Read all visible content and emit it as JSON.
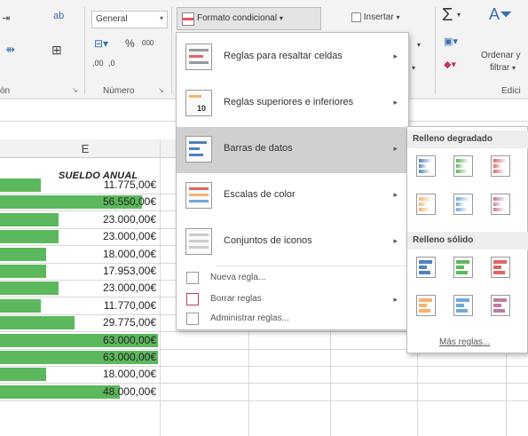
{
  "ribbon": {
    "orientation_label": "ab",
    "number_format": "General",
    "percent_label": "%",
    "thousands_label": "000",
    "decimals_label": ",00",
    "cond_format_label": "Formato condicional",
    "insert_label": "Insertar",
    "sort_label": "Ordenar y",
    "filter_label": "filtrar",
    "group_alignment": "ón",
    "group_number": "Número",
    "group_editing": "Edici"
  },
  "sheet": {
    "column_letter": "E",
    "column_header": "SUELDO ANUAL",
    "rows": [
      {
        "value": "11.775,00€",
        "fill": 0.26
      },
      {
        "value": "56.550,00€",
        "fill": 0.9
      },
      {
        "value": "23.000,00€",
        "fill": 0.37
      },
      {
        "value": "23.000,00€",
        "fill": 0.37
      },
      {
        "value": "18.000,00€",
        "fill": 0.29
      },
      {
        "value": "17.953,00€",
        "fill": 0.29
      },
      {
        "value": "23.000,00€",
        "fill": 0.37
      },
      {
        "value": "11.770,00€",
        "fill": 0.26
      },
      {
        "value": "29.775,00€",
        "fill": 0.47
      },
      {
        "value": "63.000,00€",
        "fill": 1.0
      },
      {
        "value": "63.000,00€",
        "fill": 1.0
      },
      {
        "value": "18.000,00€",
        "fill": 0.29
      },
      {
        "value": "48.000,00€",
        "fill": 0.76
      }
    ],
    "bar_color": "#5cb85c"
  },
  "menu": {
    "items": [
      {
        "label": "Reglas para resaltar celdas",
        "has_submenu": true
      },
      {
        "label": "Reglas superiores e inferiores",
        "has_submenu": true
      },
      {
        "label": "Barras de datos",
        "has_submenu": true,
        "highlighted": true
      },
      {
        "label": "Escalas de color",
        "has_submenu": true
      },
      {
        "label": "Conjuntos de iconos",
        "has_submenu": true
      }
    ],
    "small_items": [
      {
        "label": "Nueva regla...",
        "has_submenu": false
      },
      {
        "label": "Borrar reglas",
        "has_submenu": true
      },
      {
        "label": "Administrar reglas...",
        "has_submenu": false
      }
    ],
    "icon_badge": "10"
  },
  "submenu": {
    "gradient_title": "Relleno degradado",
    "solid_title": "Relleno sólido",
    "more_label": "Más reglas...",
    "swatch_colors": [
      "#4f81bd",
      "#5cb85c",
      "#e06666",
      "#f6b26b",
      "#6fa8dc",
      "#c27ba0"
    ]
  },
  "colors": {
    "highlight": "#d0d0d0",
    "ribbon_bg": "#f3f3f3"
  }
}
